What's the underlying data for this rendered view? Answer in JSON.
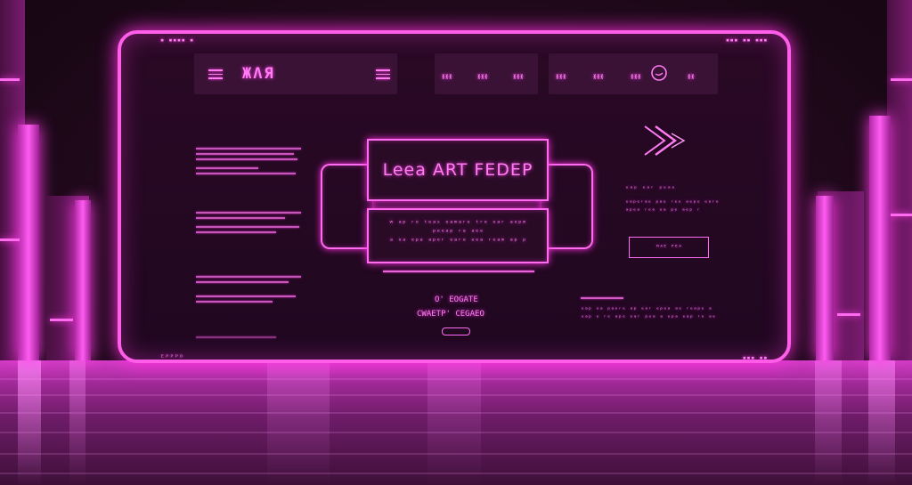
{
  "top_bar": {
    "logo_text": "ЖΛЯ",
    "nav_group_1": [
      "ᚕᚕᚕ",
      "ᚕᚕᚕ",
      "ᚕᚕᚕ"
    ],
    "nav_group_2": [
      "ᚕᚕᚕ",
      "ᚕᚕᚕ",
      "ᚕᚕᚕ"
    ],
    "top_left_micro": "▪ ▪▪▪▪ ▪",
    "top_right_micro": "▪▪▪ ▪▪ ▪▪▪"
  },
  "hero": {
    "title": "Leea ART FEDEP",
    "body": "ʷ ᵃᵖ ʳᵉ ᵗᵉᵃˢ ᵉᵃᵐᵃʳᵉ ᵗʳᵉ ᵉᵃʳ ᵃᵉᵖᵐ ᵖᵉᵉᵃᵖ ʳᵃ ᵃᵉᵉ\nᵃ ᵉᵃ ᵉᵖᵃ ᵃᵖᵉʳ ᵉᵃʳᵉ ᵉᵉᵃ ʳᵉᵃᵐ ᵃᵖ ᵖ",
    "caption_1": "O' EOGATE",
    "caption_2": "CWAETP' CEGAEO"
  },
  "right_column": {
    "heading": "ᵉᵃᵖ ᵉᵃʳ ᵖᵉᵃᵉ",
    "body": "ᵉᵃᵖᵉʳᵃᵉ ᵖᵃᵉ ʳᵉᵉ ᵃᵉᵖᵉ ᵉᵃʳᵉ ᵃᵖᵉᵃ ʳᵉᵃ ᵉᵃ ᵖᵉ ᵃᵉᵖ ʳ",
    "button": "ᴹᴬᴱ ᴾᴱᴬ",
    "bottom_text": "ᵉᵃᵖ ᵉᵃ ᵖᵃᵉʳᵉ ᵃᵖ ᵉᵃʳ ᵉᵖᵉᵃ ᵃᵉ ʳᵉᵃᵖᵉ ᵃ ᵉᵃᵖ ᵉ ʳᵉ ᵃᵖᵉ ᵉᵃʳ ᵖᵉᵃ ᵃ ᵉᵖᵃ ᵉᵃᵖ ʳᵉ ᵃᵉ"
  },
  "footer": {
    "left": "ᴱᴾᴾᴾᴰ",
    "right": "▪▪▪ ▪▪"
  },
  "colors": {
    "neon": "#ff5ee8",
    "background": "#170612",
    "panel": "#200720"
  },
  "icons": [
    "menu-icon",
    "chevron-left-icon",
    "chevron-right-icon",
    "arrow-right-icon",
    "circle-icon"
  ]
}
